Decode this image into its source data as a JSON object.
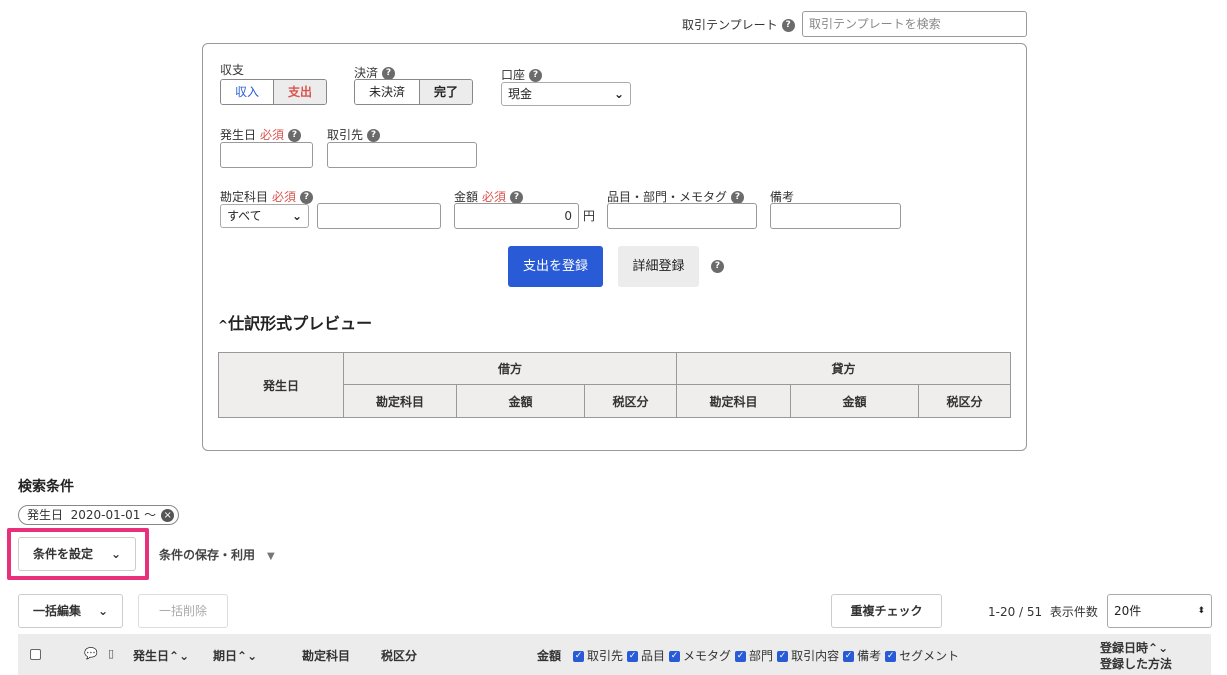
{
  "template": {
    "label": "取引テンプレート",
    "placeholder": "取引テンプレートを検索"
  },
  "form": {
    "income_expense": {
      "label": "収支",
      "income": "収入",
      "expense": "支出",
      "selected": "支出"
    },
    "settlement": {
      "label": "決済",
      "unsettled": "未決済",
      "settled": "完了",
      "selected": "完了"
    },
    "account": {
      "label": "口座",
      "value": "現金"
    },
    "date": {
      "label": "発生日",
      "required": "必須",
      "value": ""
    },
    "partner": {
      "label": "取引先",
      "value": ""
    },
    "account_item": {
      "label": "勘定科目",
      "required": "必須",
      "select_value": "すべて",
      "value": ""
    },
    "amount": {
      "label": "金額",
      "required": "必須",
      "value": "0",
      "unit": "円"
    },
    "item_tags": {
      "label": "品目・部門・メモタグ",
      "value": ""
    },
    "memo": {
      "label": "備考",
      "value": ""
    },
    "register_button": "支出を登録",
    "detail_button": "詳細登録",
    "preview_title": "仕訳形式プレビュー",
    "preview_table": {
      "date_header": "発生日",
      "debit": "借方",
      "credit": "貸方",
      "sub_headers": [
        "勘定科目",
        "金額",
        "税区分"
      ]
    }
  },
  "search": {
    "title": "検索条件",
    "chip": "発生日  2020-01-01 〜",
    "set_conditions": "条件を設定",
    "save_use": "条件の保存・利用"
  },
  "toolbar": {
    "bulk_edit": "一括編集",
    "bulk_delete": "一括削除",
    "dup_check": "重複チェック",
    "range": "1-20 / 51",
    "per_page_label": "表示件数",
    "per_page_value": "20件"
  },
  "list_header": {
    "date": "発生日",
    "due": "期日",
    "account_item": "勘定科目",
    "tax": "税区分",
    "amount": "金額",
    "toggles": [
      "取引先",
      "品目",
      "メモタグ",
      "部門",
      "取引内容",
      "備考",
      "セグメント"
    ],
    "registered_at": "登録日時",
    "registered_method": "登録した方法",
    "sort_glyph": "⌃⌄"
  }
}
